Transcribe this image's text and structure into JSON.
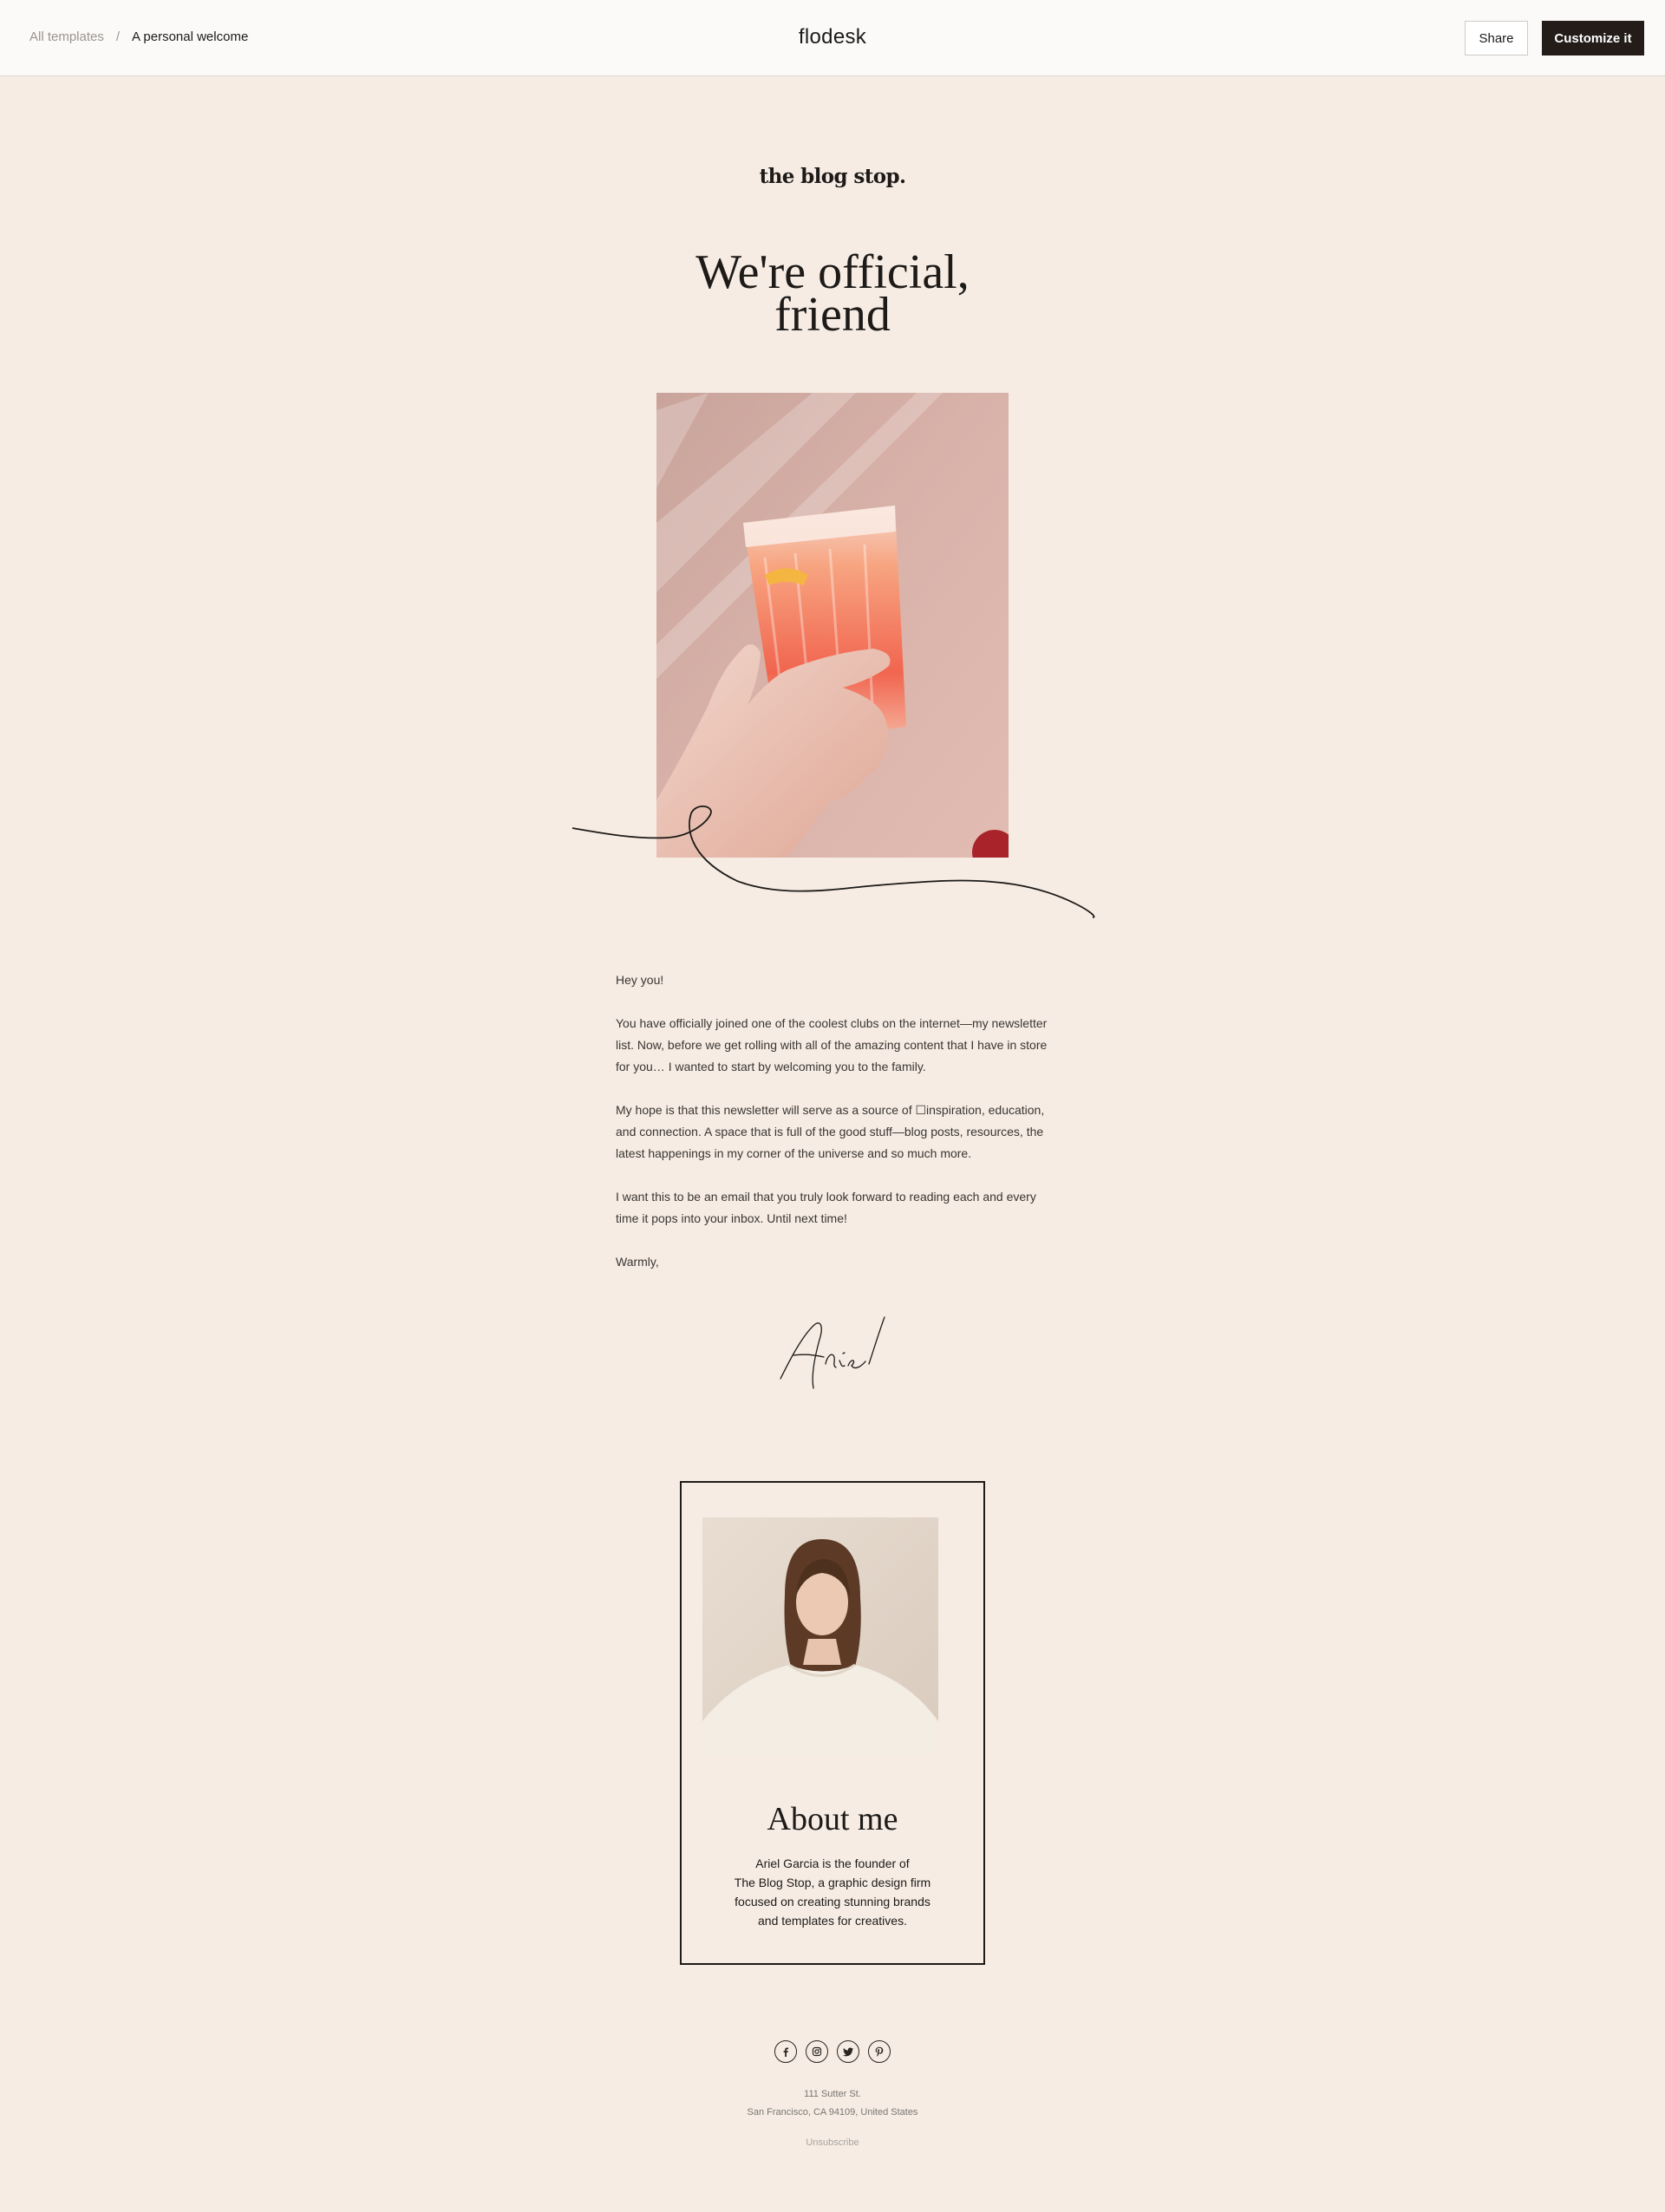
{
  "header": {
    "breadcrumb_root": "All templates",
    "breadcrumb_separator": "/",
    "breadcrumb_current": "A personal welcome",
    "brand": "flodesk",
    "share_label": "Share",
    "customize_label": "Customize it"
  },
  "email": {
    "logo": "the blog stop.",
    "headline_line1": "We're official,",
    "headline_line2": "friend",
    "hero_image": "hand-holding-pink-drink-photo",
    "greeting": "Hey you!",
    "paragraph1": "You have officially joined one of the coolest clubs on the internet—my newsletter list. Now, before we get rolling with all of the amazing content that I have in store for you… I wanted to start by welcoming you to the family.",
    "paragraph2": "My hope is that this newsletter will serve as a source of ☐inspiration, education, and connection. A space that is full of the good stuff—blog posts, resources, the latest happenings in my corner of the universe and so much more.",
    "paragraph3": "I want this to be an email that you truly look forward to reading each and every time it pops into your inbox. Until next time!",
    "signoff": "Warmly,",
    "signature_text": "Ariel"
  },
  "about": {
    "title": "About me",
    "portrait_image": "woman-portrait-photo",
    "lines": [
      "Ariel Garcia is the founder of",
      "The Blog Stop, a graphic design firm",
      "focused on creating stunning brands",
      "and templates for creatives."
    ]
  },
  "footer": {
    "social_icons": [
      "facebook-icon",
      "instagram-icon",
      "twitter-icon",
      "pinterest-icon"
    ],
    "address_line1": "111 Sutter St.",
    "address_line2": "San Francisco, CA 94109, United States",
    "unsubscribe": "Unsubscribe"
  },
  "colors": {
    "page_background": "#f6ece4",
    "topbar_background": "#fbfaf8",
    "primary_button": "#231c19",
    "text": "#1d1a18"
  }
}
